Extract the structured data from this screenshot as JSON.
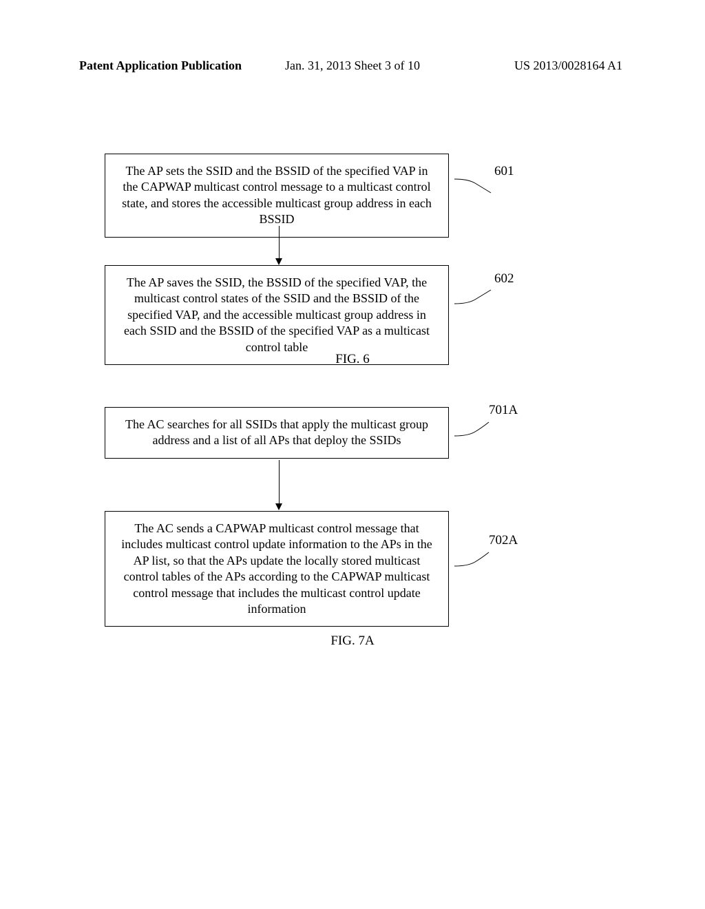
{
  "header": {
    "left": "Patent Application Publication",
    "center": "Jan. 31, 2013  Sheet 3 of 10",
    "right": "US 2013/0028164 A1"
  },
  "fig6": {
    "box1_text": "The AP sets the SSID and the BSSID of the specified VAP in the CAPWAP multicast control message to a multicast control state, and stores the accessible multicast group address in each BSSID",
    "box2_text": "The AP saves the SSID, the BSSID of the specified VAP, the multicast control states of the SSID and the BSSID of the specified VAP, and the accessible multicast group address in each SSID and the BSSID of the specified VAP as a multicast control table",
    "ref1": "601",
    "ref2": "602",
    "label": "FIG. 6"
  },
  "fig7a": {
    "box1_text": "The AC searches for all SSIDs that apply the multicast group address and a list of all APs that deploy the SSIDs",
    "box2_text": "The AC sends a CAPWAP multicast control message that includes multicast control update information to the APs in the AP list, so that the APs update the locally stored multicast control tables of the APs according to the CAPWAP multicast control message that includes the multicast control update information",
    "ref1": "701A",
    "ref2": "702A",
    "label": "FIG. 7A"
  }
}
